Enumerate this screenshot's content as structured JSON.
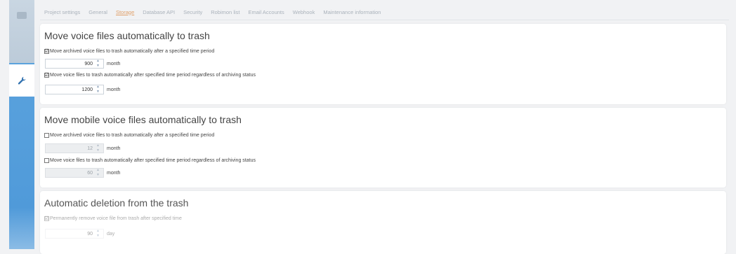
{
  "sidebar": {
    "items": [
      {
        "icon": "folder-icon",
        "active": false
      },
      {
        "icon": "wrench-icon",
        "active": true
      }
    ]
  },
  "tabs": [
    {
      "label": "Project settings",
      "active": false
    },
    {
      "label": "General",
      "active": false
    },
    {
      "label": "Storage",
      "active": true
    },
    {
      "label": "Database API",
      "active": false
    },
    {
      "label": "Security",
      "active": false
    },
    {
      "label": "Robimon list",
      "active": false
    },
    {
      "label": "Email Accounts",
      "active": false
    },
    {
      "label": "Webhook",
      "active": false
    },
    {
      "label": "Maintenance information",
      "active": false
    }
  ],
  "sections": [
    {
      "title": "Move voice files automatically to trash",
      "rows": [
        {
          "checked": true,
          "label": "Move archived voice files to trash automatically after a specified time period",
          "value": "900",
          "unit": "month",
          "disabled": false
        },
        {
          "checked": true,
          "label": "Move voice files to trash automatically after specified time period regardless of archiving status",
          "value": "1200",
          "unit": "month",
          "disabled": false
        }
      ]
    },
    {
      "title": "Move mobile voice files automatically to trash",
      "rows": [
        {
          "checked": false,
          "label": "Move archived voice files to trash automatically after a specified time period",
          "value": "12",
          "unit": "month",
          "disabled": true
        },
        {
          "checked": false,
          "label": "Move voice files to trash automatically after specified time period regardless of archiving status",
          "value": "60",
          "unit": "month",
          "disabled": true
        }
      ]
    },
    {
      "title": "Automatic deletion from the trash",
      "rows": [
        {
          "checked": true,
          "label": "Permanently remove voice file from trash after specified time",
          "value": "90",
          "unit": "day",
          "disabled": true
        }
      ]
    }
  ],
  "check_glyph": "☑",
  "colors": {
    "sidebar_blue": "#4d98d8",
    "active_tab": "#e0a06a",
    "panel_bg": "#ffffff",
    "page_bg": "#f1f2f4"
  }
}
